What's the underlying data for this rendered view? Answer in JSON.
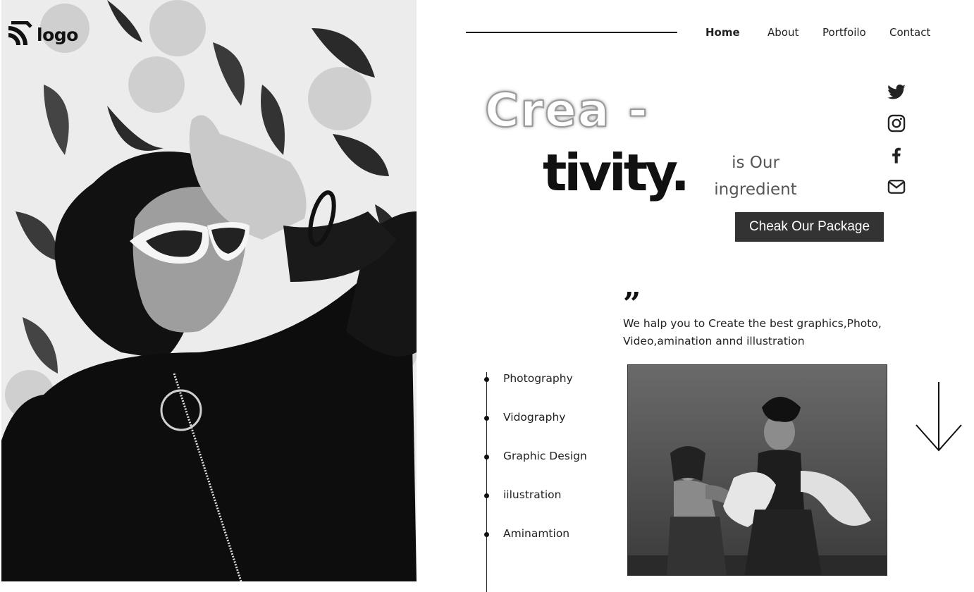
{
  "brand": {
    "logo_text": "logo",
    "logo_icon": "rss-arcs-icon"
  },
  "nav": {
    "items": [
      {
        "label": "Home",
        "active": true
      },
      {
        "label": "About"
      },
      {
        "label": "Portfoilo"
      },
      {
        "label": "Contact"
      }
    ]
  },
  "hero": {
    "title_part1": "Crea -",
    "title_part2": "tivity.",
    "tagline_line1": "is Our",
    "tagline_line2": "ingredient",
    "cta_label": "Cheak Our Package"
  },
  "social": [
    "twitter-icon",
    "instagram-icon",
    "facebook-icon",
    "mail-icon"
  ],
  "quote": {
    "mark": "”",
    "text": "We halp you to Create the best graphics,Photo, Video,amination annd illustration"
  },
  "services": [
    "Photography",
    "Vidography",
    "Graphic Design",
    "iilustration",
    "Aminamtion"
  ],
  "colors": {
    "button_bg": "#333333",
    "text": "#111111",
    "muted": "#555555"
  }
}
